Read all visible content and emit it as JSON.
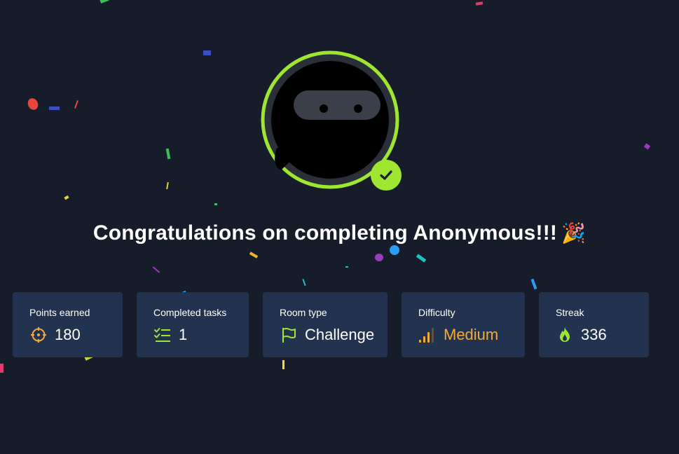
{
  "heading": {
    "text": "Congratulations on completing Anonymous!!!",
    "emoji": "🎉"
  },
  "stats": [
    {
      "label": "Points earned",
      "value": "180",
      "icon": "target-icon"
    },
    {
      "label": "Completed tasks",
      "value": "1",
      "icon": "checklist-icon"
    },
    {
      "label": "Room type",
      "value": "Challenge",
      "icon": "flag-icon"
    },
    {
      "label": "Difficulty",
      "value": "Medium",
      "icon": "signal-bars-icon"
    },
    {
      "label": "Streak",
      "value": "336",
      "icon": "flame-icon"
    }
  ],
  "colors": {
    "background": "#171c2b",
    "card": "#223350",
    "accent_green": "#9ee630",
    "accent_orange": "#f6a93b"
  }
}
